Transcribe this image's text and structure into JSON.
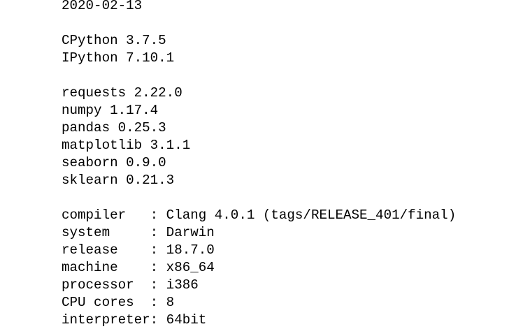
{
  "output": {
    "date": "2020-02-13",
    "versions_python": [
      "CPython 3.7.5",
      "IPython 7.10.1"
    ],
    "packages": [
      "requests 2.22.0",
      "numpy 1.17.4",
      "pandas 0.25.3",
      "matplotlib 3.1.1",
      "seaborn 0.9.0",
      "sklearn 0.21.3"
    ],
    "system_info": [
      "compiler   : Clang 4.0.1 (tags/RELEASE_401/final)",
      "system     : Darwin",
      "release    : 18.7.0",
      "machine    : x86_64",
      "processor  : i386",
      "CPU cores  : 8",
      "interpreter: 64bit"
    ]
  }
}
